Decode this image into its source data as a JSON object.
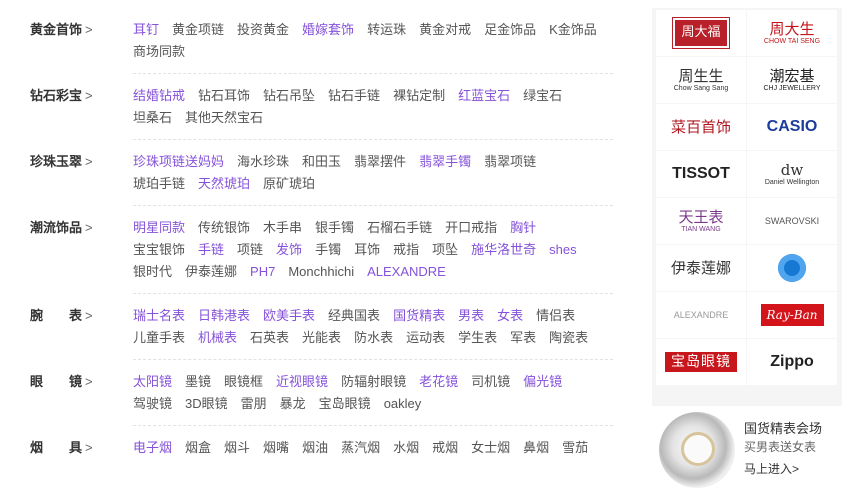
{
  "categories": [
    {
      "title": "黄金首饰",
      "links": [
        {
          "text": "耳钉",
          "hot": true
        },
        {
          "text": "黄金项链"
        },
        {
          "text": "投资黄金"
        },
        {
          "text": "婚嫁套饰",
          "hot": true
        },
        {
          "text": "转运珠"
        },
        {
          "text": "黄金对戒"
        },
        {
          "text": "足金饰品"
        },
        {
          "text": "K金饰品"
        },
        {
          "text": "商场同款"
        }
      ]
    },
    {
      "title": "钻石彩宝",
      "links": [
        {
          "text": "结婚钻戒",
          "hot": true
        },
        {
          "text": "钻石耳饰"
        },
        {
          "text": "钻石吊坠"
        },
        {
          "text": "钻石手链"
        },
        {
          "text": "裸钻定制"
        },
        {
          "text": "红蓝宝石",
          "hot": true
        },
        {
          "text": "绿宝石"
        },
        {
          "text": "坦桑石"
        },
        {
          "text": "其他天然宝石"
        }
      ]
    },
    {
      "title": "珍珠玉翠",
      "links": [
        {
          "text": "珍珠项链送妈妈",
          "hot": true
        },
        {
          "text": "海水珍珠"
        },
        {
          "text": "和田玉"
        },
        {
          "text": "翡翠摆件"
        },
        {
          "text": "翡翠手镯",
          "hot": true
        },
        {
          "text": "翡翠项链"
        },
        {
          "text": "琥珀手链"
        },
        {
          "text": "天然琥珀",
          "hot": true
        },
        {
          "text": "原矿琥珀"
        }
      ]
    },
    {
      "title": "潮流饰品",
      "links": [
        {
          "text": "明星同款",
          "hot": true
        },
        {
          "text": "传统银饰"
        },
        {
          "text": "木手串"
        },
        {
          "text": "银手镯"
        },
        {
          "text": "石榴石手链"
        },
        {
          "text": "开口戒指"
        },
        {
          "text": "胸针",
          "hot": true
        },
        {
          "text": "宝宝银饰"
        },
        {
          "text": "手链",
          "hot": true
        },
        {
          "text": "项链"
        },
        {
          "text": "发饰",
          "hot": true
        },
        {
          "text": "手镯"
        },
        {
          "text": "耳饰"
        },
        {
          "text": "戒指"
        },
        {
          "text": "项坠"
        },
        {
          "text": "施华洛世奇",
          "hot": true
        },
        {
          "text": "shes",
          "hot": true
        },
        {
          "text": "银时代"
        },
        {
          "text": "伊泰莲娜"
        },
        {
          "text": "PH7",
          "hot": true
        },
        {
          "text": "Monchhichi"
        },
        {
          "text": "ALEXANDRE",
          "hot": true
        }
      ]
    },
    {
      "title": "腕　　表",
      "links": [
        {
          "text": "瑞士名表",
          "hot": true
        },
        {
          "text": "日韩港表",
          "hot": true
        },
        {
          "text": "欧美手表",
          "hot": true
        },
        {
          "text": "经典国表"
        },
        {
          "text": "国货精表",
          "hot": true
        },
        {
          "text": "男表",
          "hot": true
        },
        {
          "text": "女表",
          "hot": true
        },
        {
          "text": "情侣表"
        },
        {
          "text": "儿童手表"
        },
        {
          "text": "机械表",
          "hot": true
        },
        {
          "text": "石英表"
        },
        {
          "text": "光能表"
        },
        {
          "text": "防水表"
        },
        {
          "text": "运动表"
        },
        {
          "text": "学生表"
        },
        {
          "text": "军表"
        },
        {
          "text": "陶瓷表"
        }
      ]
    },
    {
      "title": "眼　　镜",
      "links": [
        {
          "text": "太阳镜",
          "hot": true
        },
        {
          "text": "墨镜"
        },
        {
          "text": "眼镜框"
        },
        {
          "text": "近视眼镜",
          "hot": true
        },
        {
          "text": "防辐射眼镜"
        },
        {
          "text": "老花镜",
          "hot": true
        },
        {
          "text": "司机镜"
        },
        {
          "text": "偏光镜",
          "hot": true
        },
        {
          "text": "驾驶镜"
        },
        {
          "text": "3D眼镜"
        },
        {
          "text": "雷朋"
        },
        {
          "text": "暴龙"
        },
        {
          "text": "宝岛眼镜"
        },
        {
          "text": "oakley"
        }
      ]
    },
    {
      "title": "烟　　具",
      "links": [
        {
          "text": "电子烟",
          "hot": true
        },
        {
          "text": "烟盒"
        },
        {
          "text": "烟斗"
        },
        {
          "text": "烟嘴"
        },
        {
          "text": "烟油"
        },
        {
          "text": "蒸汽烟"
        },
        {
          "text": "水烟"
        },
        {
          "text": "戒烟"
        },
        {
          "text": "女士烟"
        },
        {
          "text": "鼻烟"
        },
        {
          "text": "雪茄"
        }
      ]
    }
  ],
  "chevron": ">",
  "brands": [
    {
      "label": "周大福",
      "color": "#b8202a",
      "style": "box"
    },
    {
      "label": "周大生",
      "sub": "CHOW TAI SENG",
      "color": "#c4161c"
    },
    {
      "label": "周生生",
      "sub": "Chow Sang Sang",
      "color": "#333333"
    },
    {
      "label": "潮宏基",
      "sub": "CHJ JEWELLERY",
      "color": "#222222"
    },
    {
      "label": "菜百首饰",
      "color": "#b0171f"
    },
    {
      "label": "CASIO",
      "color": "#1a3c9c",
      "style": "bold"
    },
    {
      "label": "TISSOT",
      "color": "#222222",
      "style": "bold"
    },
    {
      "label": "dw",
      "sub": "Daniel Wellington",
      "color": "#333333"
    },
    {
      "label": "天王表",
      "sub": "TIAN WANG",
      "color": "#7b3b8c"
    },
    {
      "label": "SWAROVSKI",
      "color": "#555555"
    },
    {
      "label": "伊泰莲娜",
      "color": "#333333"
    },
    {
      "label": "",
      "color": "#1778d4",
      "style": "circle"
    },
    {
      "label": "ALEXANDRE",
      "color": "#999999"
    },
    {
      "label": "Ray-Ban",
      "color": "#ffffff",
      "style": "ray"
    },
    {
      "label": "宝岛眼镜",
      "color": "#ffffff",
      "style": "baodao"
    },
    {
      "label": "Zippo",
      "color": "#222222",
      "style": "bold"
    }
  ],
  "promo": {
    "title": "国货精表会场",
    "subtitle": "买男表送女表",
    "link": "马上进入>"
  }
}
